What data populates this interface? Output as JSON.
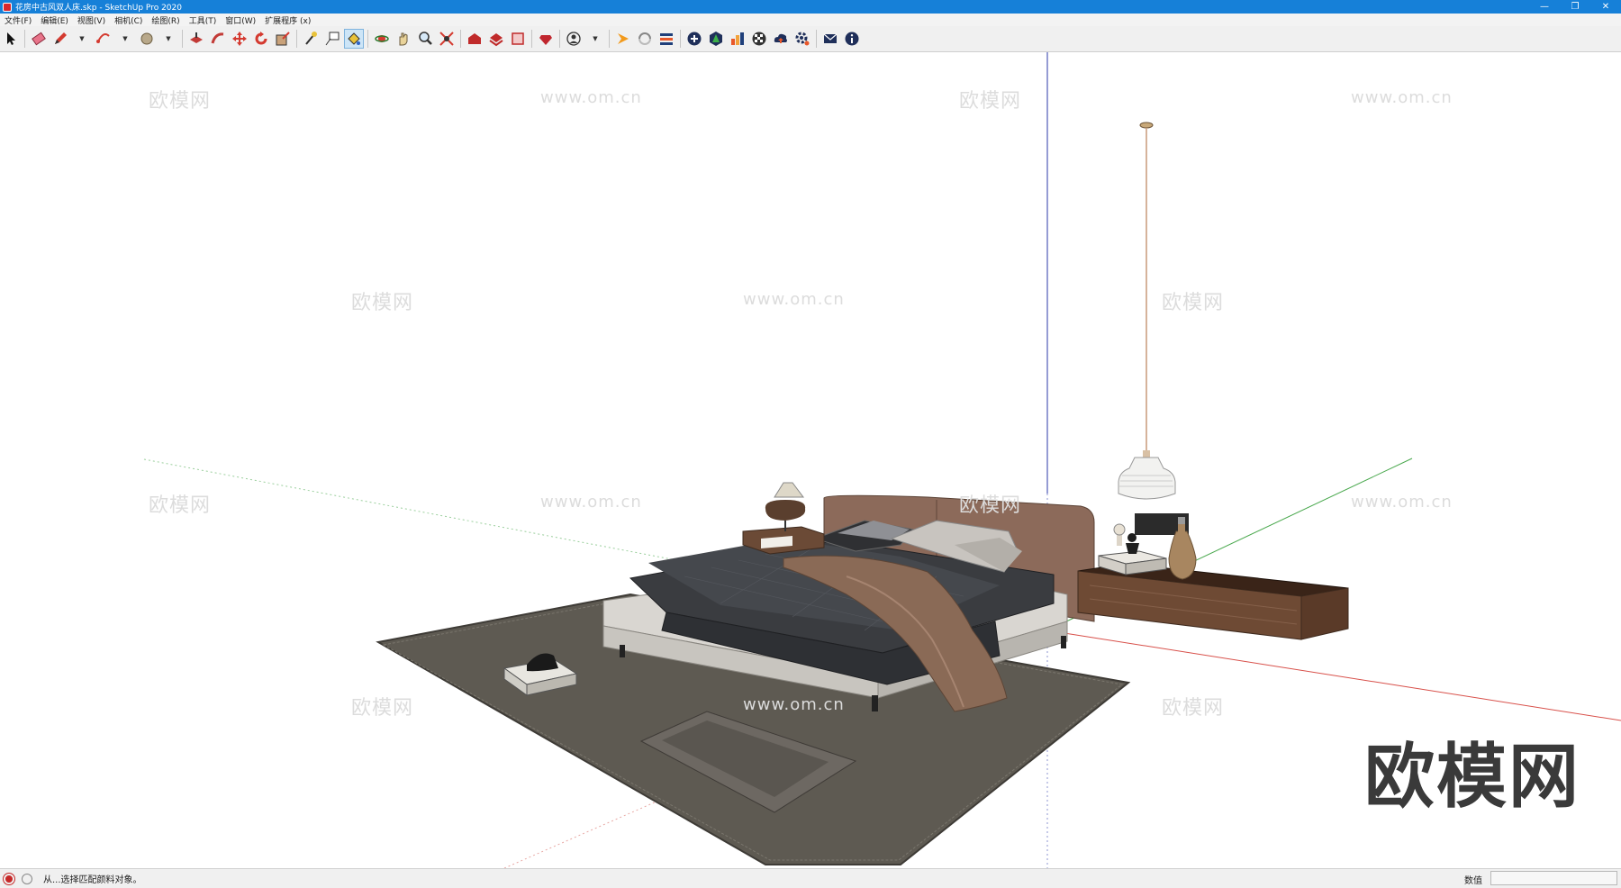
{
  "window": {
    "title": "花房中古风双人床.skp - SketchUp Pro 2020",
    "controls": {
      "minimize": "—",
      "restore": "❐",
      "close": "✕"
    }
  },
  "menu": [
    {
      "label": "文件(F)"
    },
    {
      "label": "编辑(E)"
    },
    {
      "label": "视图(V)"
    },
    {
      "label": "相机(C)"
    },
    {
      "label": "绘图(R)"
    },
    {
      "label": "工具(T)"
    },
    {
      "label": "窗口(W)"
    },
    {
      "label": "扩展程序 (x)"
    }
  ],
  "toolbar": {
    "active_tool": "paint-bucket-icon",
    "tools": [
      "select-icon",
      "eraser-icon",
      "pencil-icon",
      "arc-icon",
      "shape-icon",
      "push-pull-icon",
      "follow-me-icon",
      "move-icon",
      "rotate-icon",
      "scale-icon",
      "tape-measure-icon",
      "text-icon",
      "paint-bucket-icon",
      "orbit-icon",
      "pan-icon",
      "zoom-icon",
      "zoom-extents-icon",
      "warehouse-icon",
      "extension-warehouse-icon",
      "layout-icon",
      "ruby-icon",
      "account-icon",
      "sync-icon",
      "rotate-arrows-icon",
      "layers-icon",
      "plus-icon",
      "tree-icon",
      "bar-chart-icon",
      "checker-icon",
      "cloud-icon",
      "settings-icon",
      "mail-icon",
      "info-icon"
    ]
  },
  "viewport": {
    "watermark_logo": "欧模网",
    "watermark_url": "www.om.cn",
    "brand_watermark": "欧模网",
    "axis_colors": {
      "red": "#d8504a",
      "green": "#49a84d",
      "blue": "#2b3aa8"
    }
  },
  "status": {
    "message": "从...选择匹配颜料对象。",
    "vcb_label": "数值",
    "vcb_value": ""
  }
}
